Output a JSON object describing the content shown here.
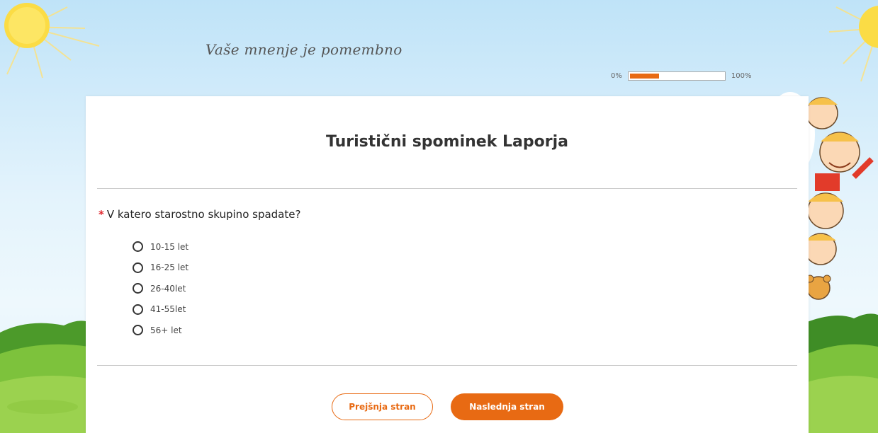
{
  "header": {
    "tagline": "Vaše mnenje je pomembno"
  },
  "progress": {
    "start_label": "0%",
    "end_label": "100%",
    "value": 0.33,
    "color": "#e86a13"
  },
  "survey": {
    "title": "Turistični spominek Laporja"
  },
  "question": {
    "required_mark": "*",
    "text": "V katero starostno skupino spadate?",
    "options": [
      "10-15 let",
      "16-25 let",
      "26-40let",
      "41-55let",
      "56+ let"
    ]
  },
  "buttons": {
    "previous_label": "Prejšnja stran",
    "next_label": "Naslednja stran"
  },
  "colors": {
    "accent": "#e86a13",
    "required": "#e0242a"
  }
}
